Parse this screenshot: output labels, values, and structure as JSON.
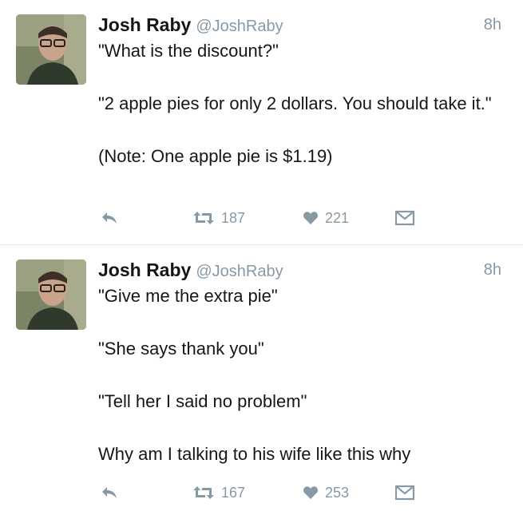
{
  "colors": {
    "text": "#14171a",
    "muted": "#8899a6",
    "divider": "#e1e8ed",
    "background": "#ffffff"
  },
  "tweets": [
    {
      "author_name": "Josh Raby",
      "handle": "@JoshRaby",
      "time": "8h",
      "paragraphs": [
        "\"What is the discount?\"",
        "\"2 apple pies for only 2 dollars. You should take it.\"",
        "(Note: One apple pie is $1.19)"
      ],
      "retweets": "187",
      "likes": "221",
      "icons": [
        "reply-icon",
        "retweet-icon",
        "heart-icon",
        "message-icon"
      ]
    },
    {
      "author_name": "Josh Raby",
      "handle": "@JoshRaby",
      "time": "8h",
      "paragraphs": [
        "\"Give me the extra pie\"",
        "\"She says thank you\"",
        "\"Tell her I said no problem\"",
        "Why am I talking to his wife like this why"
      ],
      "retweets": "167",
      "likes": "253",
      "icons": [
        "reply-icon",
        "retweet-icon",
        "heart-icon",
        "message-icon"
      ]
    }
  ]
}
